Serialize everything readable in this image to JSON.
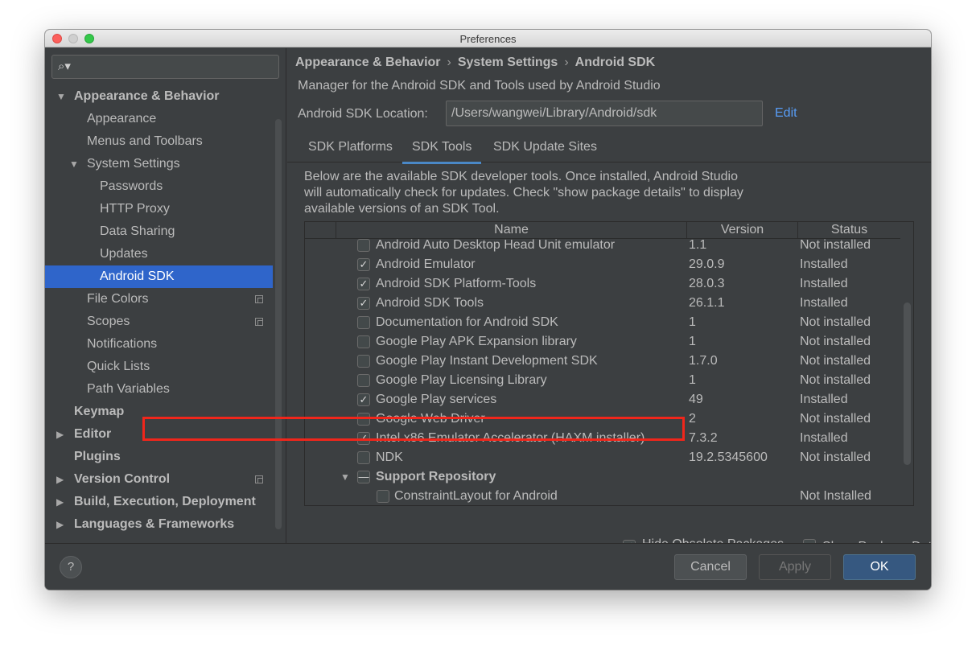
{
  "window": {
    "title": "Preferences"
  },
  "sidebar": {
    "search_placeholder": "",
    "items": [
      {
        "label": "Appearance & Behavior",
        "expanded": true
      },
      {
        "label": "Appearance"
      },
      {
        "label": "Menus and Toolbars"
      },
      {
        "label": "System Settings",
        "expanded": true
      },
      {
        "label": "Passwords"
      },
      {
        "label": "HTTP Proxy"
      },
      {
        "label": "Data Sharing"
      },
      {
        "label": "Updates"
      },
      {
        "label": "Android SDK",
        "selected": true
      },
      {
        "label": "File Colors",
        "icon": "copy-icon"
      },
      {
        "label": "Scopes",
        "icon": "copy-icon"
      },
      {
        "label": "Notifications"
      },
      {
        "label": "Quick Lists"
      },
      {
        "label": "Path Variables"
      },
      {
        "label": "Keymap"
      },
      {
        "label": "Editor",
        "expanded": false
      },
      {
        "label": "Plugins"
      },
      {
        "label": "Version Control",
        "expanded": false,
        "icon": "copy-icon"
      },
      {
        "label": "Build, Execution, Deployment",
        "expanded": false
      },
      {
        "label": "Languages & Frameworks",
        "expanded": false
      }
    ]
  },
  "main": {
    "breadcrumb": [
      "Appearance & Behavior",
      "System Settings",
      "Android SDK"
    ],
    "breadcrumb_separator": "›",
    "description": "Manager for the Android SDK and Tools used by Android Studio",
    "location_label": "Android SDK Location:",
    "location_value": "/Users/wangwei/Library/Android/sdk",
    "edit_label": "Edit",
    "tabs": [
      {
        "label": "SDK Platforms"
      },
      {
        "label": "SDK Tools",
        "active": true
      },
      {
        "label": "SDK Update Sites"
      }
    ],
    "info_lines": [
      "Below are the available SDK developer tools. Once installed, Android Studio",
      "will automatically check for updates. Check \"show package details\" to display",
      "available versions of an SDK Tool."
    ],
    "table": {
      "columns": [
        "Name",
        "Version",
        "Status"
      ],
      "rows": [
        {
          "checked": false,
          "name": "Android Auto Desktop Head Unit emulator",
          "version": "1.1",
          "status": "Not installed"
        },
        {
          "checked": true,
          "name": "Android Emulator",
          "version": "29.0.9",
          "status": "Installed"
        },
        {
          "checked": true,
          "name": "Android SDK Platform-Tools",
          "version": "28.0.3",
          "status": "Installed"
        },
        {
          "checked": true,
          "name": "Android SDK Tools",
          "version": "26.1.1",
          "status": "Installed"
        },
        {
          "checked": false,
          "name": "Documentation for Android SDK",
          "version": "1",
          "status": "Not installed"
        },
        {
          "checked": false,
          "name": "Google Play APK Expansion library",
          "version": "1",
          "status": "Not installed"
        },
        {
          "checked": false,
          "name": "Google Play Instant Development SDK",
          "version": "1.7.0",
          "status": "Not installed"
        },
        {
          "checked": false,
          "name": "Google Play Licensing Library",
          "version": "1",
          "status": "Not installed"
        },
        {
          "checked": true,
          "name": "Google Play services",
          "version": "49",
          "status": "Installed",
          "highlighted": true
        },
        {
          "checked": false,
          "name": "Google Web Driver",
          "version": "2",
          "status": "Not installed"
        },
        {
          "checked": true,
          "name": "Intel x86 Emulator Accelerator (HAXM installer)",
          "version": "7.3.2",
          "status": "Installed"
        },
        {
          "checked": false,
          "name": "NDK",
          "version": "19.2.5345600",
          "status": "Not installed"
        },
        {
          "group": true,
          "partial": true,
          "name": "Support Repository",
          "version": "",
          "status": ""
        },
        {
          "checked": false,
          "child": true,
          "name": "ConstraintLayout for Android",
          "version": "",
          "status": "Not Installed"
        }
      ]
    },
    "options": {
      "hide_obsolete": {
        "label": "Hide Obsolete Packages",
        "checked": true
      },
      "show_details": {
        "label": "Show Package Details",
        "checked": false
      }
    }
  },
  "footer": {
    "help": "?",
    "cancel": "Cancel",
    "apply": "Apply",
    "ok": "OK"
  },
  "colors": {
    "selection": "#2f65ca",
    "link": "#589df6",
    "highlight_box": "#f0261b",
    "primary_button": "#365880"
  }
}
